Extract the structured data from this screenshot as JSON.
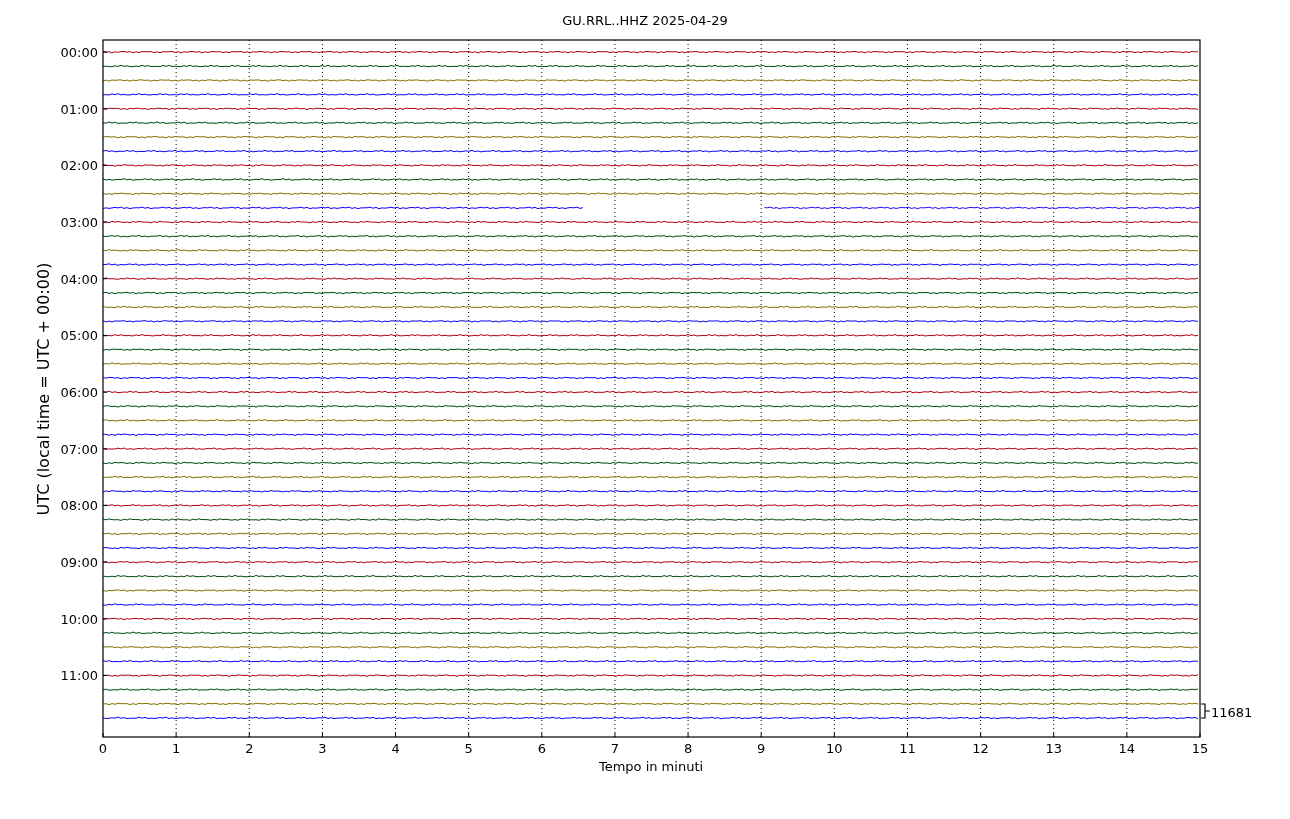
{
  "title": "GU.RRL..HHZ 2025-04-29",
  "xlabel": "Tempo in minuti",
  "ylabel": "UTC (local time = UTC + 00:00)",
  "xticks": [
    "0",
    "1",
    "2",
    "3",
    "4",
    "5",
    "6",
    "7",
    "8",
    "9",
    "10",
    "11",
    "12",
    "13",
    "14",
    "15"
  ],
  "hour_labels": [
    "00:00",
    "01:00",
    "02:00",
    "03:00",
    "04:00",
    "05:00",
    "06:00",
    "07:00",
    "08:00",
    "09:00",
    "10:00",
    "11:00"
  ],
  "scale_label": "11681",
  "traces": [
    {
      "color": "#b2000f"
    },
    {
      "color": "#004c12"
    },
    {
      "color": "#847200"
    },
    {
      "color": "#0e01ff"
    },
    {
      "color": "#b2000f"
    },
    {
      "color": "#004c12"
    },
    {
      "color": "#847200"
    },
    {
      "color": "#0e01ff"
    },
    {
      "color": "#b2000f"
    },
    {
      "color": "#004c12"
    },
    {
      "color": "#847200"
    },
    {
      "color": "#0e01ff",
      "segments": [
        {
          "level": 0.44
        },
        {
          "level": 0.397
        }
      ]
    },
    {
      "color": "#b2000f"
    },
    {
      "color": "#004c12"
    },
    {
      "color": "#847200"
    },
    {
      "color": "#0e01ff"
    },
    {
      "color": "#b2000f"
    },
    {
      "color": "#004c12"
    },
    {
      "color": "#847200"
    },
    {
      "color": "#0e01ff"
    },
    {
      "color": "#b2000f"
    },
    {
      "color": "#004c12"
    },
    {
      "color": "#847200"
    },
    {
      "color": "#0e01ff"
    },
    {
      "color": "#b2000f"
    },
    {
      "color": "#004c12"
    },
    {
      "color": "#847200"
    },
    {
      "color": "#0e01ff"
    },
    {
      "color": "#b2000f"
    },
    {
      "color": "#004c12"
    },
    {
      "color": "#847200"
    },
    {
      "color": "#0e01ff"
    },
    {
      "color": "#b2000f"
    },
    {
      "color": "#004c12"
    },
    {
      "color": "#847200"
    },
    {
      "color": "#0e01ff"
    },
    {
      "color": "#b2000f"
    },
    {
      "color": "#004c12"
    },
    {
      "color": "#847200"
    },
    {
      "color": "#0e01ff"
    },
    {
      "color": "#b2000f"
    },
    {
      "color": "#004c12"
    },
    {
      "color": "#847200"
    },
    {
      "color": "#0e01ff"
    },
    {
      "color": "#b2000f"
    },
    {
      "color": "#004c12"
    },
    {
      "color": "#847200"
    },
    {
      "color": "#0e01ff"
    }
  ]
}
